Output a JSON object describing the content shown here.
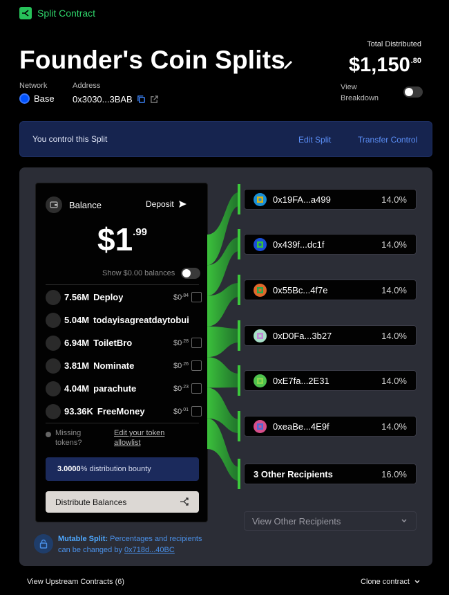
{
  "brand": {
    "label": "Split Contract",
    "color": "#2fd36a"
  },
  "split": {
    "title": "Founder's Coin Splits"
  },
  "total": {
    "label": "Total Distributed",
    "whole": "$1,150",
    "cents": ".80"
  },
  "network": {
    "label": "Network",
    "value": "Base"
  },
  "address": {
    "label": "Address",
    "value": "0x3030...3BAB"
  },
  "breakdown": {
    "line1": "View",
    "line2": "Breakdown",
    "enabled": false
  },
  "banner": {
    "text": "You control this Split",
    "edit": "Edit Split",
    "transfer": "Transfer Control"
  },
  "balance": {
    "label": "Balance",
    "deposit": "Deposit",
    "whole": "$1",
    "cents": ".99",
    "show_zero": "Show $0.00 balances",
    "tokens": [
      {
        "amount": "7.56M",
        "name": "Deploy",
        "value": "$0",
        "value_sup": ".84",
        "checkbox": true
      },
      {
        "amount": "5.04M",
        "name": "todayisagreatdaytobui",
        "value": "",
        "value_sup": "",
        "checkbox": false
      },
      {
        "amount": "6.94M",
        "name": "ToiletBro",
        "value": "$0",
        "value_sup": ".28",
        "checkbox": true
      },
      {
        "amount": "3.81M",
        "name": "Nominate",
        "value": "$0",
        "value_sup": ".26",
        "checkbox": true
      },
      {
        "amount": "4.04M",
        "name": "parachute",
        "value": "$0",
        "value_sup": ".23",
        "checkbox": true
      },
      {
        "amount": "93.36K",
        "name": "FreeMoney",
        "value": "$0",
        "value_sup": ".01",
        "checkbox": true
      }
    ],
    "missing_line1": "Missing",
    "missing_line2": "tokens?",
    "edit_allowlist_line1": "Edit your token",
    "edit_allowlist_line2": "allowlist",
    "bounty_pct": "3.0000",
    "bounty_text": "% distribution bounty",
    "distribute": "Distribute Balances"
  },
  "recipients": [
    {
      "address": "0x19FA...a499",
      "pct": "14.0%",
      "colors": [
        "#1a8fd6",
        "#d6b21a"
      ]
    },
    {
      "address": "0x439f...dc1f",
      "pct": "14.0%",
      "colors": [
        "#1a4fd6",
        "#3ac23a"
      ]
    },
    {
      "address": "0x55Bc...4f7e",
      "pct": "14.0%",
      "colors": [
        "#e0682a",
        "#2aa84e"
      ]
    },
    {
      "address": "0xD0Fa...3b27",
      "pct": "14.0%",
      "colors": [
        "#a8e0c8",
        "#c28ad6"
      ]
    },
    {
      "address": "0xE7fa...2E31",
      "pct": "14.0%",
      "colors": [
        "#4ec24e",
        "#8ad64e"
      ]
    },
    {
      "address": "0xeaBe...4E9f",
      "pct": "14.0%",
      "colors": [
        "#d64e8a",
        "#4e6ad6"
      ]
    }
  ],
  "others": {
    "label": "3 Other Recipients",
    "pct": "16.0%"
  },
  "view_other": "View Other Recipients",
  "mutable": {
    "title": "Mutable Split:",
    "text1": " Percentages and recipients",
    "text2": "can be changed by ",
    "address": "0x718d...40BC"
  },
  "footer": {
    "upstream": "View Upstream Contracts (6)",
    "clone": "Clone contract"
  },
  "colors": {
    "accent_green": "#2fd36a",
    "flow_green": "#3cc83c",
    "banner_bg": "#16244f",
    "link_blue": "#5b8ef6"
  }
}
